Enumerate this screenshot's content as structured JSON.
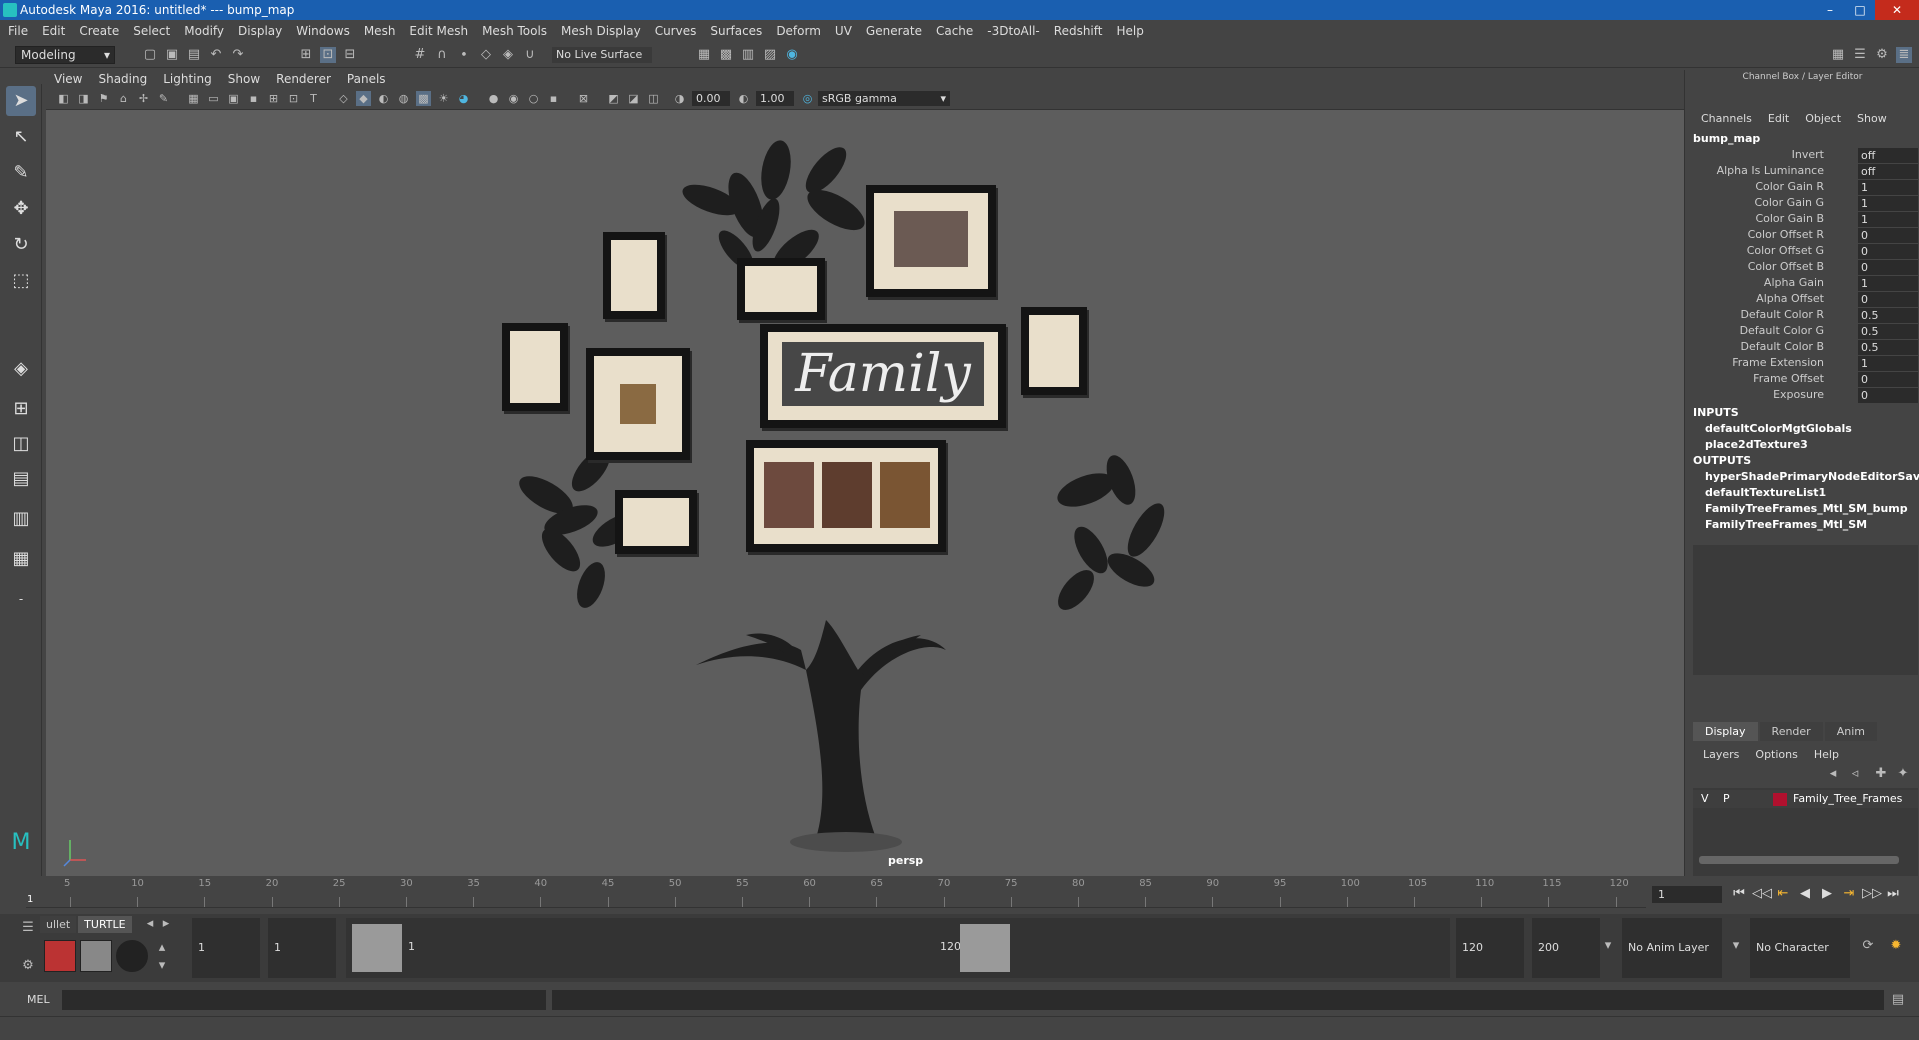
{
  "window": {
    "title": "Autodesk Maya 2016: untitled*   ---   bump_map",
    "min": "–",
    "max": "□",
    "close": "✕"
  },
  "menubar": [
    "File",
    "Edit",
    "Create",
    "Select",
    "Modify",
    "Display",
    "Windows",
    "Mesh",
    "Edit Mesh",
    "Mesh Tools",
    "Mesh Display",
    "Curves",
    "Surfaces",
    "Deform",
    "UV",
    "Generate",
    "Cache",
    "-3DtoAll-",
    "Redshift",
    "Help"
  ],
  "statusline": {
    "mode": "Modeling",
    "live_surface": "No Live Surface"
  },
  "viewport": {
    "menu": [
      "View",
      "Shading",
      "Lighting",
      "Show",
      "Renderer",
      "Panels"
    ],
    "exposure": "0.00",
    "gamma": "1.00",
    "color_space": "sRGB gamma",
    "camera": "persp",
    "family_text": "Family"
  },
  "channel_box": {
    "title": "Channel Box / Layer Editor",
    "menu": [
      "Channels",
      "Edit",
      "Object",
      "Show"
    ],
    "node": "bump_map",
    "attrs": [
      {
        "label": "Invert",
        "value": "off"
      },
      {
        "label": "Alpha Is Luminance",
        "value": "off"
      },
      {
        "label": "Color Gain R",
        "value": "1"
      },
      {
        "label": "Color Gain G",
        "value": "1"
      },
      {
        "label": "Color Gain B",
        "value": "1"
      },
      {
        "label": "Color Offset R",
        "value": "0"
      },
      {
        "label": "Color Offset G",
        "value": "0"
      },
      {
        "label": "Color Offset B",
        "value": "0"
      },
      {
        "label": "Alpha Gain",
        "value": "1"
      },
      {
        "label": "Alpha Offset",
        "value": "0"
      },
      {
        "label": "Default Color R",
        "value": "0.5"
      },
      {
        "label": "Default Color G",
        "value": "0.5"
      },
      {
        "label": "Default Color B",
        "value": "0.5"
      },
      {
        "label": "Frame Extension",
        "value": "1"
      },
      {
        "label": "Frame Offset",
        "value": "0"
      },
      {
        "label": "Exposure",
        "value": "0"
      }
    ],
    "inputs_title": "INPUTS",
    "inputs": [
      "defaultColorMgtGlobals",
      "place2dTexture3"
    ],
    "outputs_title": "OUTPUTS",
    "outputs": [
      "hyperShadePrimaryNodeEditorSavedT...",
      "defaultTextureList1",
      "FamilyTreeFrames_Mtl_SM_bump",
      "FamilyTreeFrames_Mtl_SM"
    ]
  },
  "layer_editor": {
    "tabs": [
      "Display",
      "Render",
      "Anim"
    ],
    "menu": [
      "Layers",
      "Options",
      "Help"
    ],
    "layer": {
      "v": "V",
      "p": "P",
      "name": "Family_Tree_Frames",
      "color": "#b0102e"
    }
  },
  "timeline": {
    "ticks": [
      "5",
      "10",
      "15",
      "20",
      "25",
      "30",
      "35",
      "40",
      "45",
      "50",
      "55",
      "60",
      "65",
      "70",
      "75",
      "80",
      "85",
      "90",
      "95",
      "100",
      "105",
      "110",
      "115",
      "120"
    ],
    "start_tick": "1",
    "current_frame": "1"
  },
  "range": {
    "shelf_tabs": [
      "ullet",
      "TURTLE"
    ],
    "start": "1",
    "anim_start": "1",
    "slider_start": "1",
    "slider_end": "120",
    "anim_end": "120",
    "end": "200",
    "anim_layer": "No Anim Layer",
    "char_set": "No Character Set"
  },
  "mel": {
    "label": "MEL"
  }
}
